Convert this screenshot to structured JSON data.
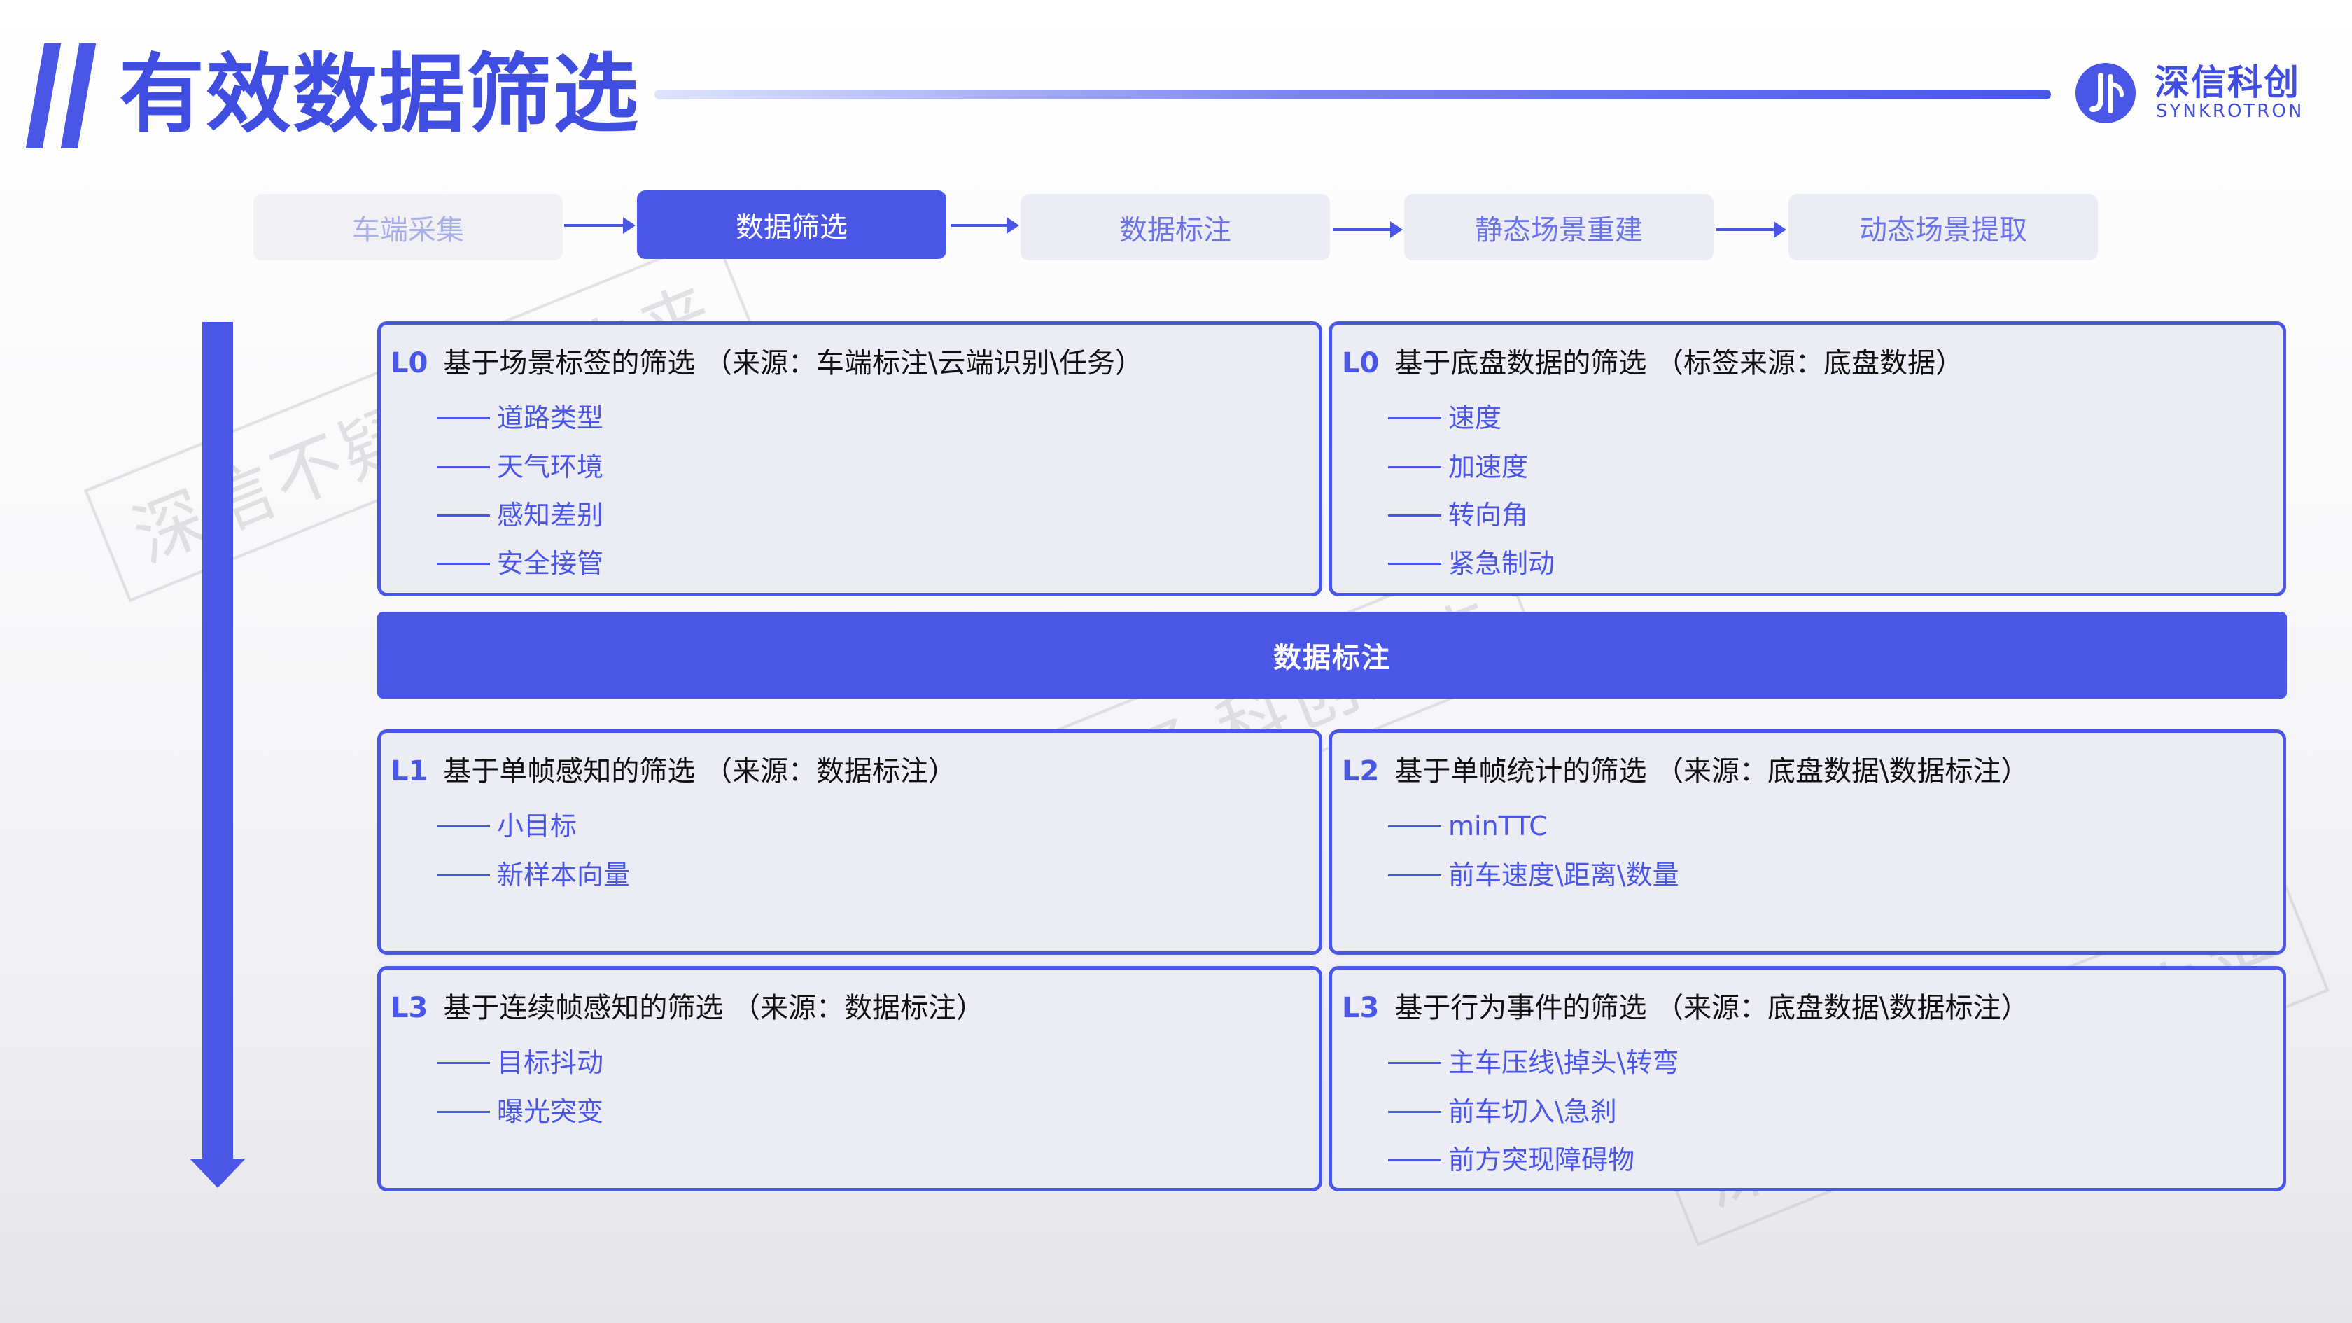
{
  "header": {
    "title": "有效数据筛选",
    "logo_cn": "深信科创",
    "logo_en": "SYNKROTRON"
  },
  "pipeline": [
    {
      "label": "车端采集"
    },
    {
      "label": "数据筛选"
    },
    {
      "label": "数据标注"
    },
    {
      "label": "静态场景重建"
    },
    {
      "label": "动态场景提取"
    }
  ],
  "boxes": {
    "l0_left": {
      "level": "L0",
      "title": "基于场景标签的筛选 （来源：车端标注\\云端识别\\任务）",
      "items": [
        "道路类型",
        "天气环境",
        "感知差别",
        "安全接管"
      ]
    },
    "l0_right": {
      "level": "L0",
      "title": "基于底盘数据的筛选 （标签来源：底盘数据）",
      "items": [
        "速度",
        "加速度",
        "转向角",
        "紧急制动"
      ]
    },
    "l1": {
      "level": "L1",
      "title": "基于单帧感知的筛选 （来源：数据标注）",
      "items": [
        "小目标",
        "新样本向量"
      ]
    },
    "l2": {
      "level": "L2",
      "title": "基于单帧统计的筛选 （来源：底盘数据\\数据标注）",
      "items": [
        "minTTC",
        "前车速度\\距离\\数量"
      ]
    },
    "l3_left": {
      "level": "L3",
      "title": "基于连续帧感知的筛选 （来源：数据标注）",
      "items": [
        "目标抖动",
        "曝光突变"
      ]
    },
    "l3_right": {
      "level": "L3",
      "title": "基于行为事件的筛选 （来源：底盘数据\\数据标注）",
      "items": [
        "主车压线\\掉头\\转弯",
        "前车切入\\急刹",
        "前方突现障碍物"
      ]
    }
  },
  "banner": "数据标注",
  "watermark": "深信不疑 科创未来",
  "colors": {
    "accent": "#4a56e6",
    "box_bg": "#ececf5"
  }
}
